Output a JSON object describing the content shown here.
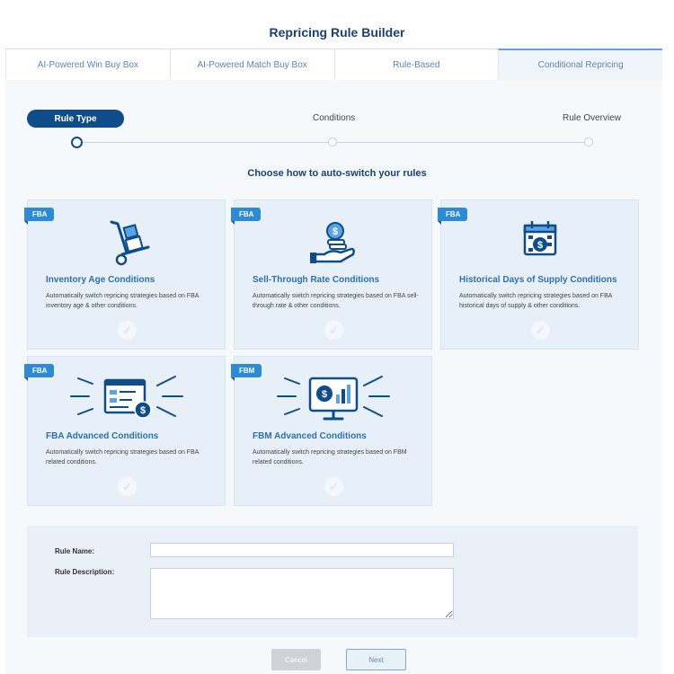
{
  "page_title": "Repricing Rule Builder",
  "tabs": [
    {
      "label": "AI-Powered Win Buy Box",
      "active": false
    },
    {
      "label": "AI-Powered Match Buy Box",
      "active": false
    },
    {
      "label": "Rule-Based",
      "active": false
    },
    {
      "label": "Conditional Repricing",
      "active": true
    }
  ],
  "stepper": {
    "steps": [
      {
        "label": "Rule Type",
        "active": true
      },
      {
        "label": "Conditions",
        "active": false
      },
      {
        "label": "Rule Overview",
        "active": false
      }
    ]
  },
  "subtitle": "Choose how to auto-switch your rules",
  "cards": [
    {
      "badge": "FBA",
      "title": "Inventory Age Conditions",
      "description": "Automatically switch repricing strategies based on FBA inventory age & other conditions.",
      "icon": "hand-truck-icon"
    },
    {
      "badge": "FBA",
      "title": "Sell-Through Rate Conditions",
      "description": "Automatically switch repricing strategies based on FBA sell-through rate & other conditions.",
      "icon": "hand-coins-icon"
    },
    {
      "badge": "FBA",
      "title": "Historical Days of Supply Conditions",
      "description": "Automatically switch repricing strategies based on FBA historical days of supply & other conditions.",
      "icon": "calendar-dollar-icon"
    },
    {
      "badge": "FBA",
      "title": "FBA Advanced Conditions",
      "description": "Automatically switch repricing strategies based on FBA related conditions.",
      "icon": "document-dollar-icon"
    },
    {
      "badge": "FBM",
      "title": "FBM Advanced Conditions",
      "description": "Automatically switch repricing strategies based on FBM related conditions.",
      "icon": "monitor-chart-icon"
    }
  ],
  "form": {
    "rule_name_label": "Rule Name:",
    "rule_name_value": "",
    "rule_description_label": "Rule Description:",
    "rule_description_value": ""
  },
  "buttons": {
    "cancel": "Cancel",
    "next": "Next"
  },
  "colors": {
    "primary_dark": "#0f4c8a",
    "accent_blue": "#2d8ad6",
    "card_bg": "#e7f0f9",
    "title_blue": "#1a3f7a"
  }
}
